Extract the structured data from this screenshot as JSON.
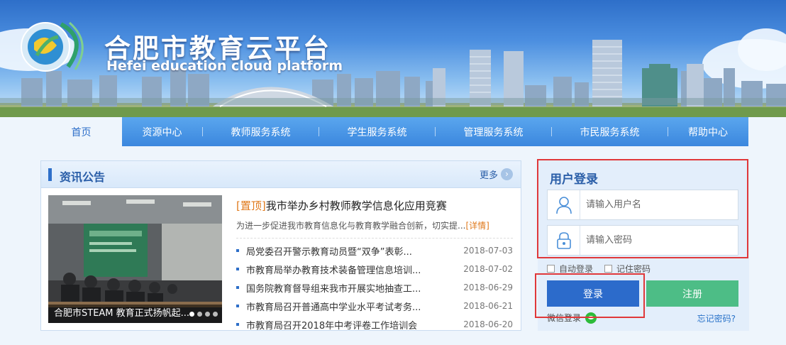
{
  "site": {
    "title": "合肥市教育云平台",
    "subtitle": "Hefei education cloud platform"
  },
  "nav": {
    "items": [
      {
        "label": "首页",
        "active": true
      },
      {
        "label": "资源中心"
      },
      {
        "label": "教师服务系统"
      },
      {
        "label": "学生服务系统"
      },
      {
        "label": "管理服务系统"
      },
      {
        "label": "市民服务系统"
      },
      {
        "label": "帮助中心"
      }
    ]
  },
  "news": {
    "title": "资讯公告",
    "more_label": "更多",
    "more_icon": "chevron-right-icon",
    "photo_caption": "合肥市STEAM 教育正式扬帆起...",
    "headline_tag": "[置顶]",
    "headline": "我市举办乡村教师教学信息化应用竞赛",
    "summary": "为进一步促进我市教育信息化与教育教学融合创新，切实提...",
    "detail_label": "[详情]",
    "items": [
      {
        "title": "局党委召开警示教育动员暨“双争”表彰...",
        "date": "2018-07-03"
      },
      {
        "title": "市教育局举办教育技术装备管理信息培训...",
        "date": "2018-07-02"
      },
      {
        "title": "国务院教育督导组来我市开展实地抽查工...",
        "date": "2018-06-29"
      },
      {
        "title": "市教育局召开普通高中学业水平考试考务...",
        "date": "2018-06-21"
      },
      {
        "title": "市教育局召开2018年中考评卷工作培训会",
        "date": "2018-06-20"
      }
    ]
  },
  "login": {
    "title": "用户登录",
    "username_placeholder": "请输入用户名",
    "password_placeholder": "请输入密码",
    "auto_login_label": "自动登录",
    "remember_label": "记住密码",
    "login_button": "登录",
    "register_button": "注册",
    "wechat_label": "微信登录",
    "forgot_label": "忘记密码?"
  },
  "colors": {
    "nav": "#3b87de",
    "accent": "#2c6bcb",
    "register": "#4dbd86",
    "highlight": "#e0383a",
    "tag": "#e07a1c"
  }
}
